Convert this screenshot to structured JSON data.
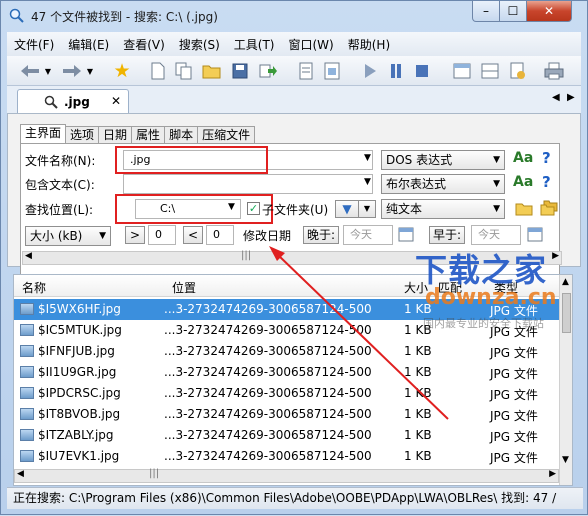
{
  "title": "47 个文件被找到 - 搜索: C:\\ (.jpg)",
  "window_buttons": {
    "minimize": "–",
    "maximize": "☐",
    "close": "✕"
  },
  "menu": [
    "文件(F)",
    "编辑(E)",
    "查看(V)",
    "搜索(S)",
    "工具(T)",
    "窗口(W)",
    "帮助(H)"
  ],
  "doc_tab": {
    "label": ".jpg",
    "close": "✕"
  },
  "subtabs": [
    "主界面",
    "选项",
    "日期",
    "属性",
    "脚本",
    "压缩文件"
  ],
  "form": {
    "filename_label": "文件名称(N):",
    "filename_value": ".jpg",
    "filename_mode": "DOS 表达式",
    "contains_label": "包含文本(C):",
    "contains_value": "",
    "contains_mode": "布尔表达式",
    "location_label": "查找位置(L):",
    "location_value": "C:\\",
    "subfolder_label": "子文件夹(U)",
    "subfolder_checked": "✓",
    "text_mode": "纯文本",
    "size_unit": "大小 (kB)",
    "size_gt": ">",
    "size_gt_value": "0",
    "size_lt": "<",
    "size_lt_value": "0",
    "modified_label": "修改日期",
    "after_label": "晚于:",
    "after_value": "今天",
    "before_label": "早于:",
    "before_value": "今天",
    "aa": "Aa",
    "help": "?"
  },
  "list": {
    "headers": [
      "名称",
      "位置",
      "大小",
      "匹配",
      "类型"
    ],
    "rows": [
      {
        "name": "$I5WX6HF.jpg",
        "location": "...3-2732474269-3006587124-500",
        "size": "1 KB",
        "type": "JPG 文件"
      },
      {
        "name": "$IC5MTUK.jpg",
        "location": "...3-2732474269-3006587124-500",
        "size": "1 KB",
        "type": "JPG 文件"
      },
      {
        "name": "$IFNFJUB.jpg",
        "location": "...3-2732474269-3006587124-500",
        "size": "1 KB",
        "type": "JPG 文件"
      },
      {
        "name": "$II1U9GR.jpg",
        "location": "...3-2732474269-3006587124-500",
        "size": "1 KB",
        "type": "JPG 文件"
      },
      {
        "name": "$IPDCRSC.jpg",
        "location": "...3-2732474269-3006587124-500",
        "size": "1 KB",
        "type": "JPG 文件"
      },
      {
        "name": "$IT8BVOB.jpg",
        "location": "...3-2732474269-3006587124-500",
        "size": "1 KB",
        "type": "JPG 文件"
      },
      {
        "name": "$ITZABLY.jpg",
        "location": "...3-2732474269-3006587124-500",
        "size": "1 KB",
        "type": "JPG 文件"
      },
      {
        "name": "$IU7EVK1.jpg",
        "location": "...3-2732474269-3006587124-500",
        "size": "1 KB",
        "type": "JPG 文件"
      }
    ]
  },
  "status": "正在搜索: C:\\Program Files (x86)\\Common Files\\Adobe\\OOBE\\PDApp\\LWA\\OBLRes\\ 找到: 47 /",
  "watermark": {
    "line1": "下载之家",
    "line2": "downza.cn",
    "line3": "国内最专业的安全下载站"
  },
  "colors": {
    "selection": "#3b8fdd",
    "highlight_box": "#e02020",
    "arrow": "#e02020"
  }
}
